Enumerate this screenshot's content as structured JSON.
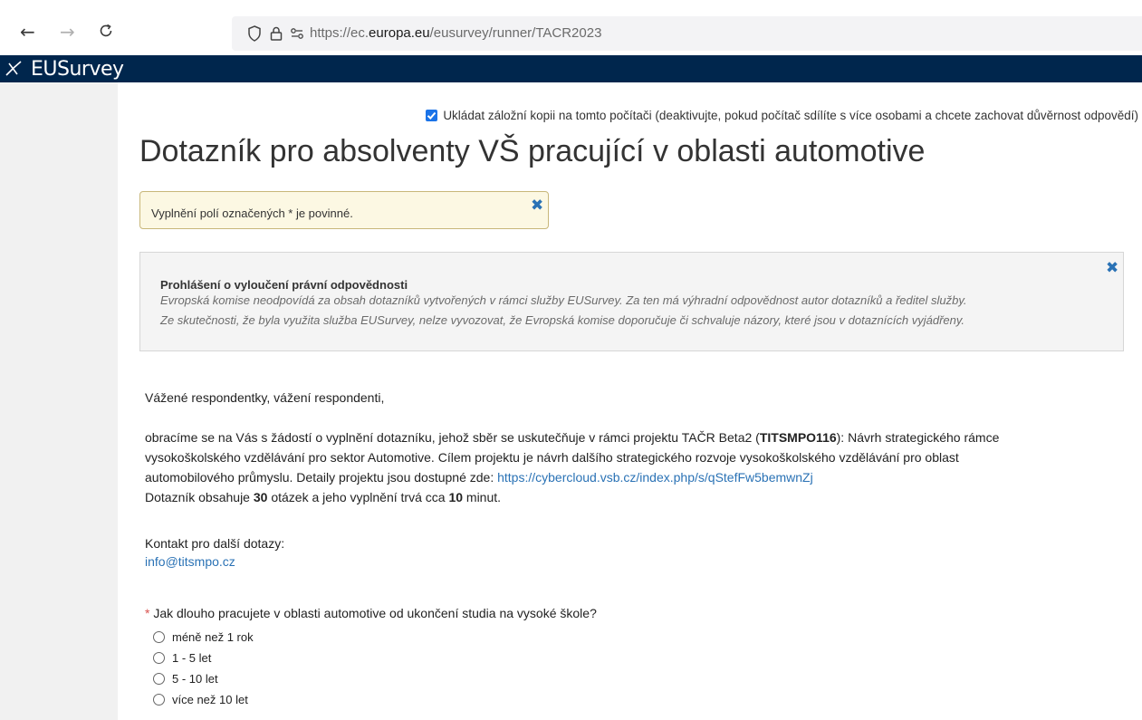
{
  "browser": {
    "url_prefix": "https://ec.",
    "url_domain": "europa.eu",
    "url_path": "/eusurvey/runner/TACR2023"
  },
  "header": {
    "logo_text": "EUSurvey"
  },
  "backup": {
    "checked": true,
    "label": "Ukládat záložní kopii na tomto počítači (deaktivujte, pokud počítač sdílíte s více osobami a chcete zachovat důvěrnost odpovědí)"
  },
  "survey": {
    "title": "Dotazník pro absolventy VŠ pracující v oblasti automotive"
  },
  "required_notice": {
    "text": "Vyplnění polí označených * je povinné."
  },
  "disclaimer": {
    "title": "Prohlášení o vyloučení právní odpovědnosti",
    "line1": "Evropská komise neodpovídá za obsah dotazníků vytvořených v rámci služby EUSurvey. Za ten má výhradní odpovědnost autor dotazníků a ředitel služby.",
    "line2": "Ze skutečnosti, že byla využita služba EUSurvey, nelze vyvozovat, že Evropská komise doporučuje či schvaluje názory, které jsou v dotaznících vyjádřeny."
  },
  "intro": {
    "greeting": "Vážené respondentky, vážení respondenti,",
    "p1_a": "obracíme se na Vás s žádostí o vyplnění dotazníku, jehož sběr se uskutečňuje v rámci projektu TAČR Beta2 (",
    "p1_code": "TITSMPO116",
    "p1_b": "): Návrh strategického rámce",
    "p1_line2": "vysokoškolského vzdělávání pro sektor Automotive. Cílem projektu je návrh dalšího strategického rozvoje vysokoškolského vzdělávání pro oblast",
    "p1_line3": "automobilového průmyslu. Detaily projektu jsou dostupné zde: ",
    "project_link": "https://cybercloud.vsb.cz/index.php/s/qStefFw5bemwnZj",
    "count_a": "Dotazník obsahuje ",
    "count_questions": "30",
    "count_b": " otázek a jeho vyplnění trvá cca ",
    "count_minutes": "10",
    "count_c": " minut.",
    "contact_label": "Kontakt pro další dotazy:",
    "contact_email": "info@titsmpo.cz"
  },
  "question1": {
    "required_mark": "*",
    "text": "Jak dlouho pracujete v oblasti automotive od ukončení studia na vysoké škole?",
    "options": [
      "méně než 1 rok",
      "1 - 5 let",
      "5 - 10 let",
      "více než 10 let"
    ]
  }
}
